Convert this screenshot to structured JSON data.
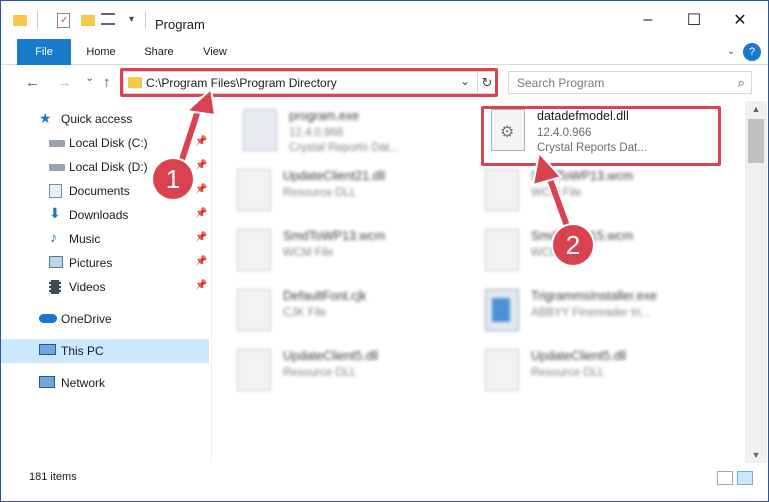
{
  "window": {
    "title": "Program",
    "controls": {
      "minimize": "–",
      "maximize": "☐",
      "close": "✕"
    }
  },
  "ribbon": {
    "tabs": [
      "File",
      "Home",
      "Share",
      "View"
    ],
    "expand_icon": "chevron-down-icon",
    "help_icon": "?"
  },
  "nav": {
    "back": "←",
    "forward": "→",
    "recent": "⌄",
    "up": "↑",
    "address": "C:\\Program Files\\Program Directory",
    "address_dropdown": "⌄",
    "refresh": "↻",
    "search_placeholder": "Search Program",
    "search_icon": "⌕"
  },
  "sidebar": {
    "items": [
      {
        "label": "Quick access",
        "icon": "star-icon",
        "pinned": false
      },
      {
        "label": "Local Disk (C:)",
        "icon": "drive-icon",
        "pinned": true
      },
      {
        "label": "Local Disk (D:)",
        "icon": "drive-icon",
        "pinned": true
      },
      {
        "label": "Documents",
        "icon": "documents-icon",
        "pinned": true
      },
      {
        "label": "Downloads",
        "icon": "download-icon",
        "pinned": true
      },
      {
        "label": "Music",
        "icon": "music-icon",
        "pinned": true
      },
      {
        "label": "Pictures",
        "icon": "pictures-icon",
        "pinned": true
      },
      {
        "label": "Videos",
        "icon": "videos-icon",
        "pinned": true
      },
      {
        "label": "OneDrive",
        "icon": "cloud-icon",
        "pinned": false
      },
      {
        "label": "This PC",
        "icon": "computer-icon",
        "pinned": false
      },
      {
        "label": "Network",
        "icon": "network-icon",
        "pinned": false
      }
    ]
  },
  "files": [
    {
      "name": "program.exe",
      "line2": "12.4.0.966",
      "line3": "Crystal Reports Dat...",
      "blurred": true
    },
    {
      "name": "datadefmodel.dll",
      "line2": "12.4.0.966",
      "line3": "Crystal Reports Dat...",
      "blurred": false
    },
    {
      "name": "UpdateClient21.dll",
      "line2": "Resource DLL",
      "line3": "",
      "blurred": true
    },
    {
      "name": "SmdToWP13.wcm",
      "line2": "WCM File",
      "line3": "",
      "blurred": true
    },
    {
      "name": "SmdToWP13.wcm",
      "line2": "WCM File",
      "line3": "",
      "blurred": true
    },
    {
      "name": "SmdToWP15.wcm",
      "line2": "WCM File",
      "line3": "",
      "blurred": true
    },
    {
      "name": "DefaultFont.cjk",
      "line2": "CJK File",
      "line3": "",
      "blurred": true
    },
    {
      "name": "TrigrammsInstaller.exe",
      "line2": "ABBYY Finereader tri...",
      "line3": "",
      "blurred": true
    },
    {
      "name": "UpdateClient5.dll",
      "line2": "Resource DLL",
      "line3": "",
      "blurred": true
    },
    {
      "name": "UpdateClient5.dll",
      "line2": "Resource DLL",
      "line3": "",
      "blurred": true
    }
  ],
  "status": {
    "item_count": "181 items"
  },
  "annotations": {
    "step1": "1",
    "step2": "2"
  },
  "colors": {
    "accent": "#1979ca",
    "highlight": "#d9434f",
    "selected": "#cce8ff",
    "folder": "#f3c84b"
  }
}
